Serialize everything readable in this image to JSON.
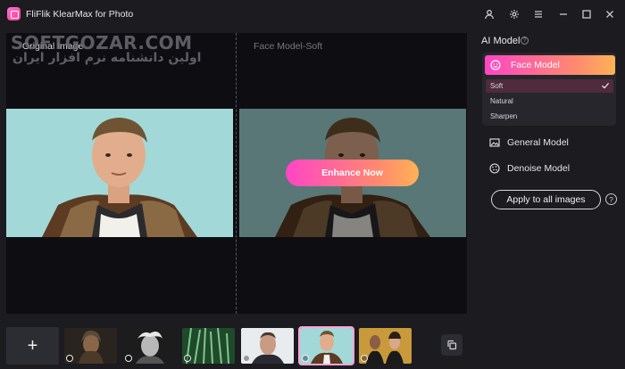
{
  "app": {
    "title": "FliFlik KlearMax for Photo",
    "brand_color": "#ff45c6"
  },
  "titlebar": {
    "icons": [
      "user-icon",
      "gear-icon",
      "menu-icon",
      "minimize-icon",
      "maximize-icon",
      "close-icon"
    ]
  },
  "watermark": {
    "text": "SOFTGOZAR.COM",
    "subtext": "اولین دانشنامه نرم افزار ایران"
  },
  "preview": {
    "left_label": "Original Image",
    "right_label": "Face Model-Soft",
    "enhance_label": "Enhance Now"
  },
  "ai_model": {
    "title": "AI Model",
    "face_model": "Face Model",
    "options": [
      {
        "label": "Soft",
        "selected": true
      },
      {
        "label": "Natural",
        "selected": false
      },
      {
        "label": "Sharpen",
        "selected": false
      }
    ],
    "general_model": "General Model",
    "denoise_model": "Denoise Model",
    "apply_label": "Apply to all images",
    "help": "?",
    "info": "?"
  },
  "filmstrip": {
    "add_label": "+",
    "thumbnails": [
      {
        "name": "thumb-portrait-hooded",
        "active": false
      },
      {
        "name": "thumb-einstein",
        "active": false
      },
      {
        "name": "thumb-grass",
        "active": false
      },
      {
        "name": "thumb-actor-house",
        "active": false
      },
      {
        "name": "thumb-macklemore",
        "active": true
      },
      {
        "name": "thumb-pulp-fiction",
        "active": false
      }
    ]
  }
}
